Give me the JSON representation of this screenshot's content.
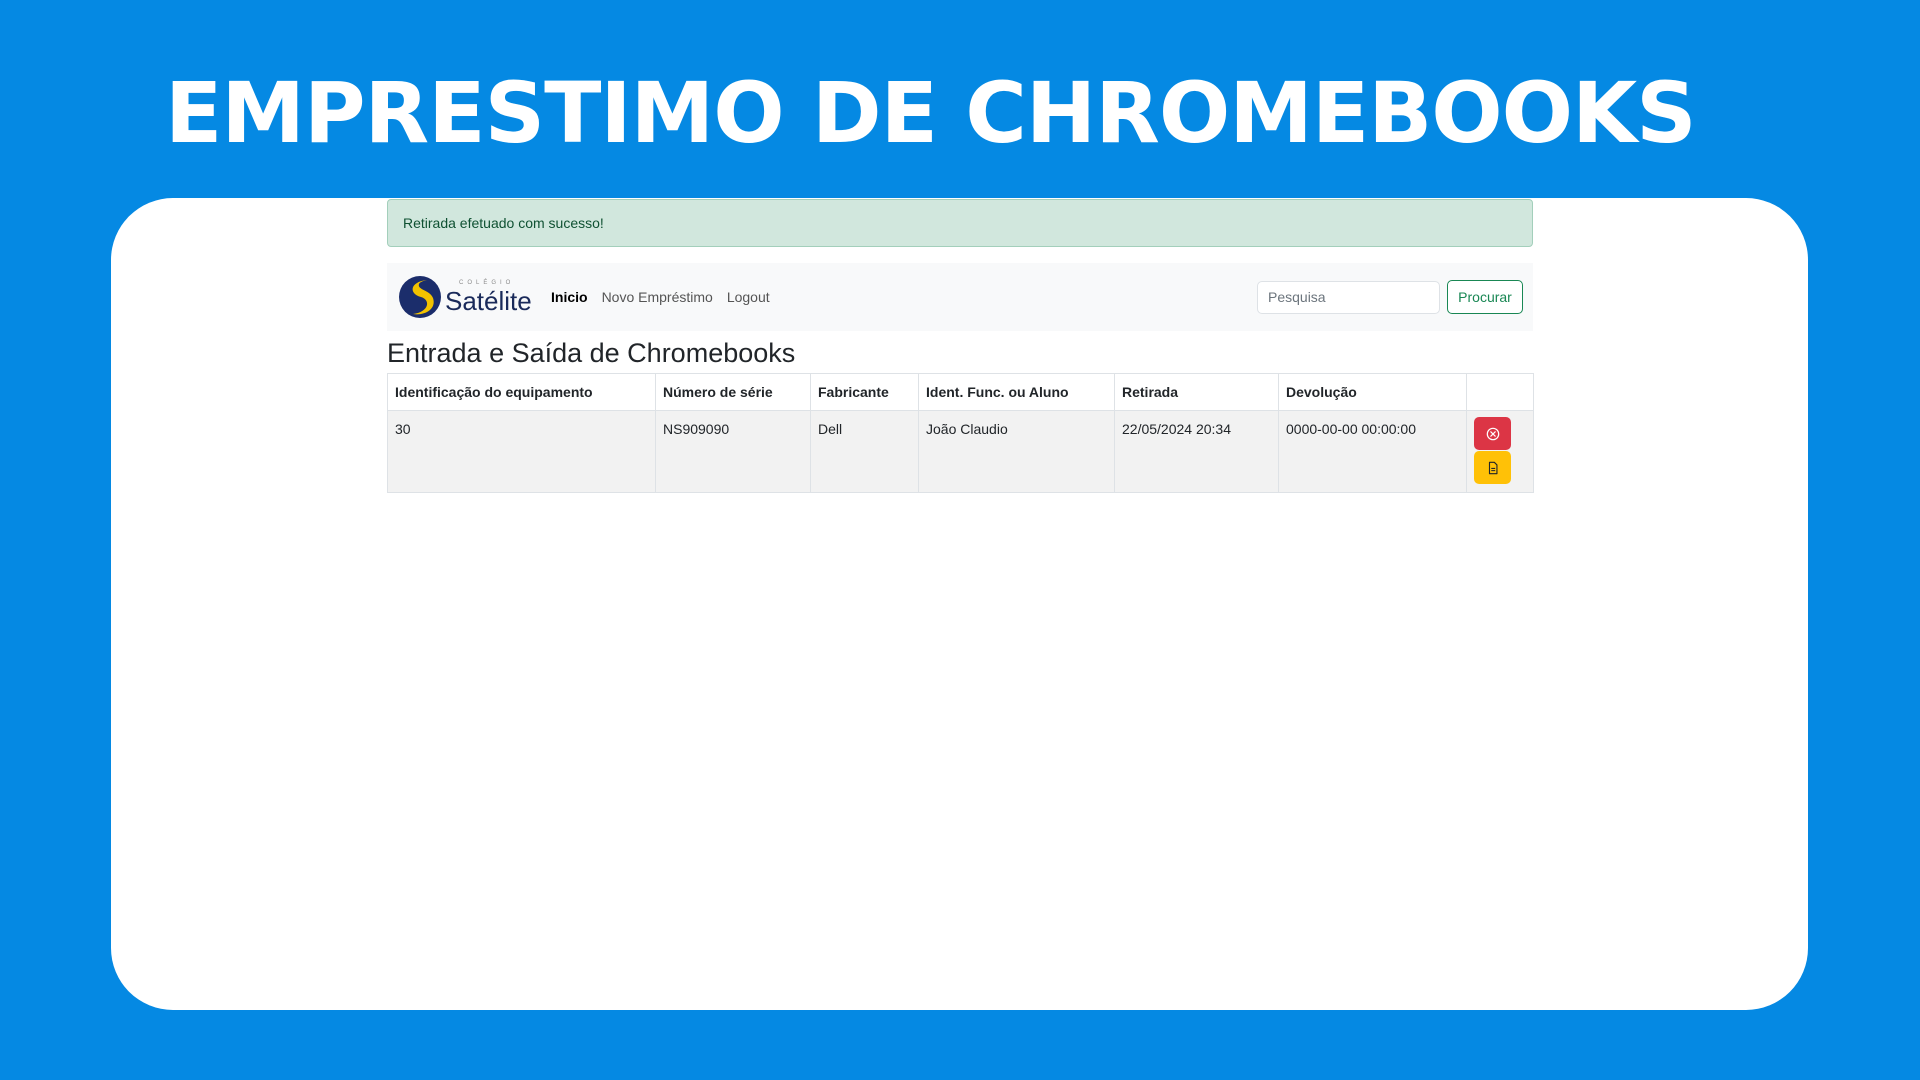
{
  "slide": {
    "title": "EMPRESTIMO DE CHROMEBOOKS"
  },
  "alert": {
    "message": "Retirada efetuado com sucesso!"
  },
  "navbar": {
    "logo": {
      "small_text": "COLÉGIO",
      "name": "Satélite"
    },
    "links": [
      {
        "label": "Inicio",
        "active": true
      },
      {
        "label": "Novo Empréstimo",
        "active": false
      },
      {
        "label": "Logout",
        "active": false
      }
    ],
    "search": {
      "placeholder": "Pesquisa",
      "value": "",
      "button_label": "Procurar"
    }
  },
  "page": {
    "heading": "Entrada e Saída de Chromebooks"
  },
  "table": {
    "columns": [
      "Identificação do equipamento",
      "Número de série",
      "Fabricante",
      "Ident. Func. ou Aluno",
      "Retirada",
      "Devolução",
      ""
    ],
    "rows": [
      {
        "id": "30",
        "serial": "NS909090",
        "manufacturer": "Dell",
        "person": "João Claudio",
        "checkout": "22/05/2024 20:34",
        "return": "0000-00-00 00:00:00",
        "actions": [
          {
            "icon": "x-circle-icon",
            "style": "danger"
          },
          {
            "icon": "file-icon",
            "style": "warning"
          }
        ]
      }
    ]
  },
  "colors": {
    "background": "#0589e3",
    "card": "#ffffff",
    "alert_bg": "#d1e7dd",
    "success": "#198754",
    "danger": "#dc3545",
    "warning": "#ffc107"
  }
}
